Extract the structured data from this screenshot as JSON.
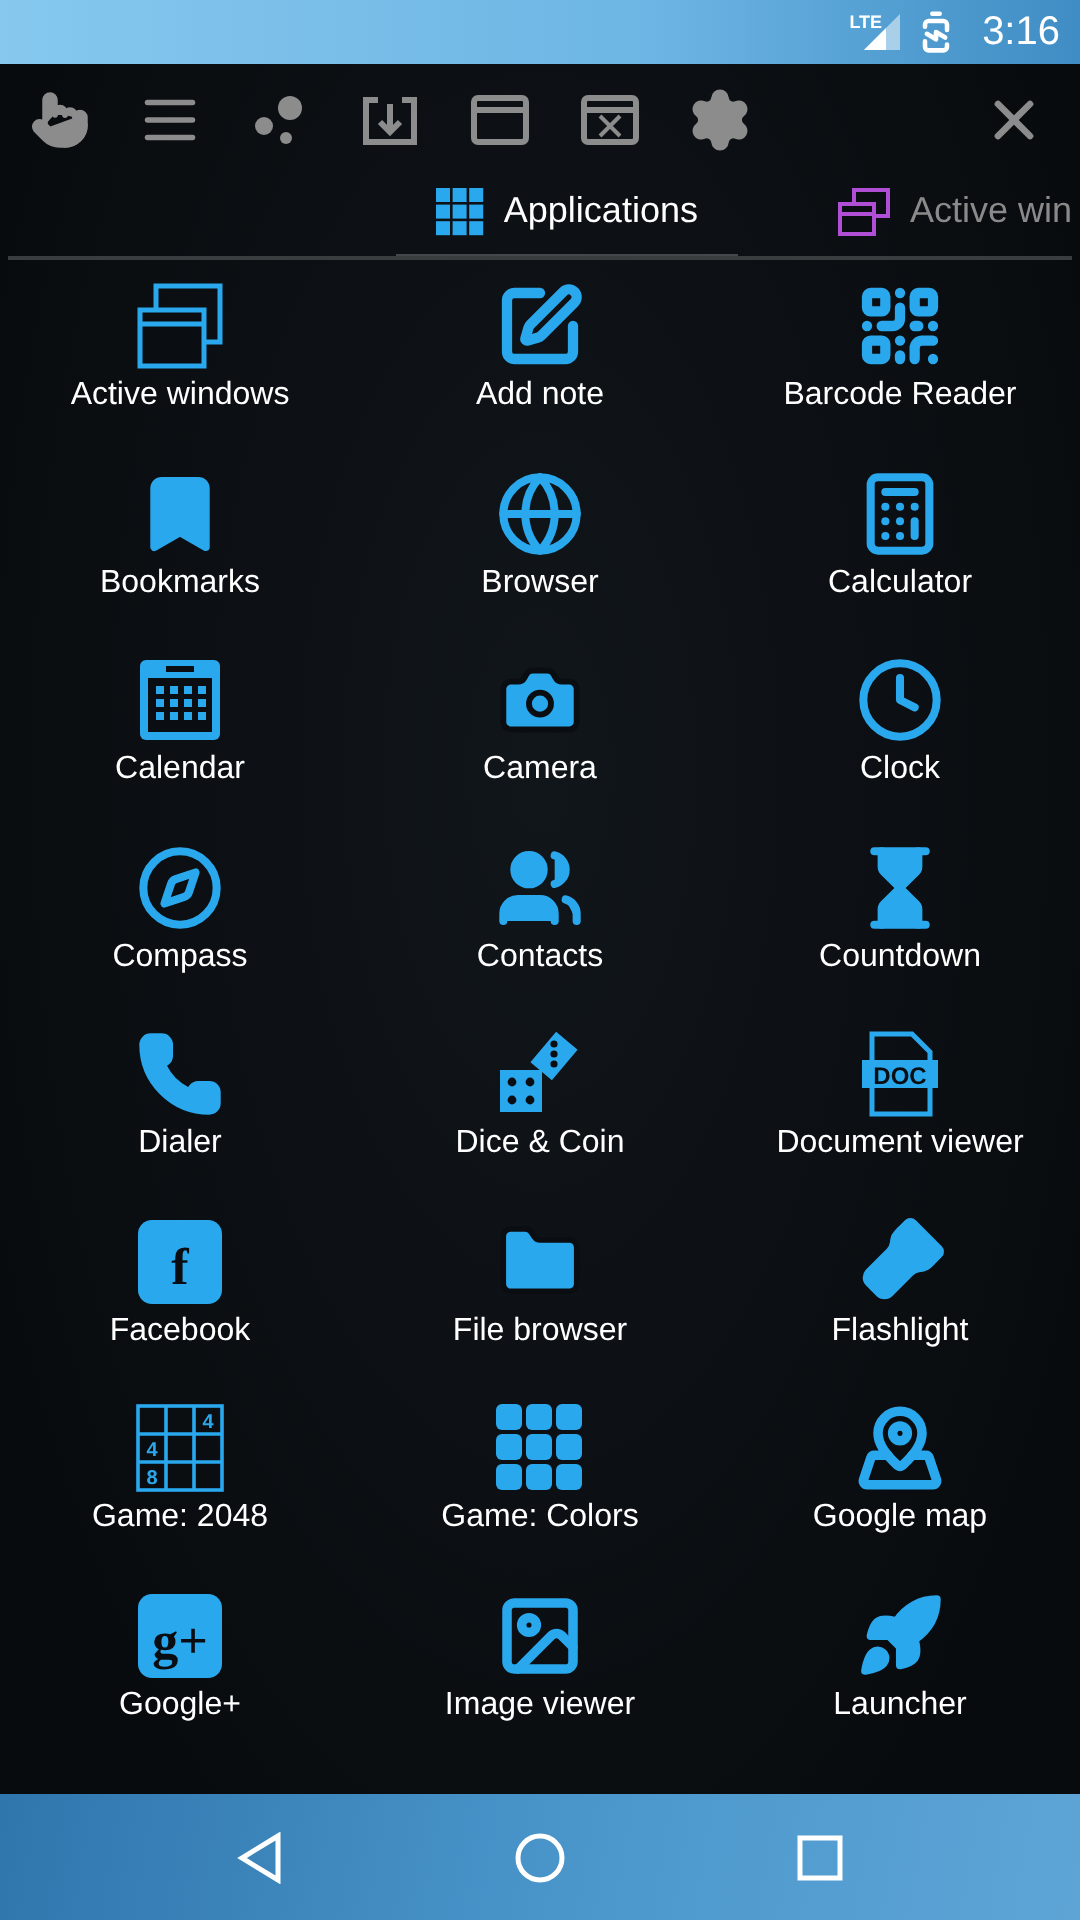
{
  "status_bar": {
    "network": "LTE",
    "time": "3:16"
  },
  "tabs": [
    {
      "label": "Applications",
      "selected": true
    },
    {
      "label": "Active win",
      "selected": false
    }
  ],
  "apps": [
    {
      "label": "Active windows",
      "kind": "windows"
    },
    {
      "label": "Add note",
      "kind": "note"
    },
    {
      "label": "Barcode Reader",
      "kind": "qr"
    },
    {
      "label": "Bookmarks",
      "kind": "bookmark"
    },
    {
      "label": "Browser",
      "kind": "globe"
    },
    {
      "label": "Calculator",
      "kind": "calculator"
    },
    {
      "label": "Calendar",
      "kind": "calendar"
    },
    {
      "label": "Camera",
      "kind": "camera"
    },
    {
      "label": "Clock",
      "kind": "clock"
    },
    {
      "label": "Compass",
      "kind": "compass"
    },
    {
      "label": "Contacts",
      "kind": "people"
    },
    {
      "label": "Countdown",
      "kind": "hourglass"
    },
    {
      "label": "Dialer",
      "kind": "phone"
    },
    {
      "label": "Dice & Coin",
      "kind": "dice"
    },
    {
      "label": "Document viewer",
      "kind": "doc",
      "icon_text": "DOC"
    },
    {
      "label": "Facebook",
      "kind": "tile",
      "icon_text": "f"
    },
    {
      "label": "File browser",
      "kind": "folder"
    },
    {
      "label": "Flashlight",
      "kind": "flashlight"
    },
    {
      "label": "Game: 2048",
      "kind": "numbers",
      "cells": [
        "4",
        "4",
        "8"
      ]
    },
    {
      "label": "Game: Colors",
      "kind": "tiles"
    },
    {
      "label": "Google map",
      "kind": "map"
    },
    {
      "label": "Google+",
      "kind": "tile",
      "icon_text": "g+"
    },
    {
      "label": "Image viewer",
      "kind": "image"
    },
    {
      "label": "Launcher",
      "kind": "rocket"
    }
  ]
}
